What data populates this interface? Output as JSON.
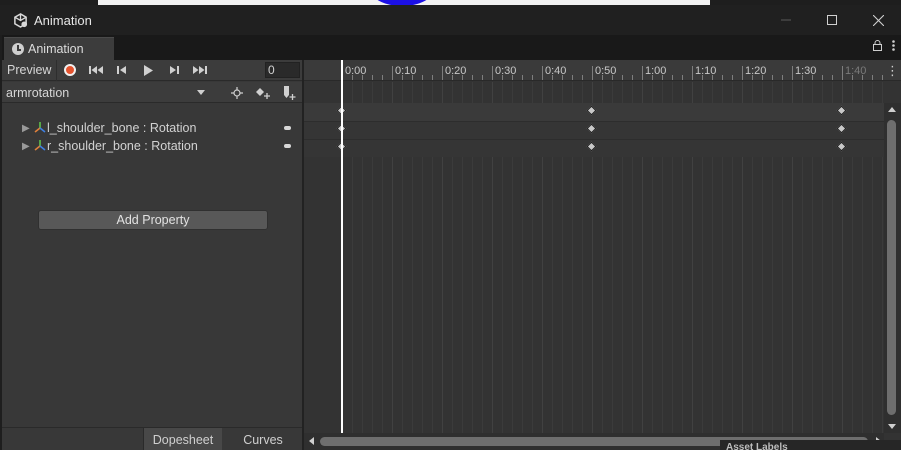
{
  "window": {
    "title": "Animation",
    "icon": "unity-icon",
    "controls": [
      "minimize-icon",
      "maximize-icon",
      "close-icon"
    ]
  },
  "tab": {
    "label": "Animation",
    "icon": "clock-icon",
    "tools": [
      "lock-icon",
      "kebab-menu-icon"
    ]
  },
  "toolbar": {
    "preview_label": "Preview",
    "buttons": [
      "record-icon",
      "first-key-icon",
      "prev-key-icon",
      "play-icon",
      "next-key-icon",
      "last-key-icon"
    ],
    "frame_value": "0"
  },
  "clip": {
    "selected": "armrotation",
    "tools": [
      "filter-by-selection-icon",
      "add-keyframe-icon",
      "add-event-icon"
    ]
  },
  "properties": [
    {
      "label": "l_shoulder_bone : Rotation",
      "icon": "bone-icon"
    },
    {
      "label": "r_shoulder_bone : Rotation",
      "icon": "bone-icon"
    }
  ],
  "add_property_label": "Add Property",
  "bottom_tabs": {
    "dopesheet": "Dopesheet",
    "curves": "Curves",
    "active": "Dopesheet"
  },
  "timeline": {
    "ticks": [
      "0:00",
      "0:10",
      "0:20",
      "0:30",
      "0:40",
      "0:50",
      "1:00",
      "1:10",
      "1:20",
      "1:30",
      "1:40"
    ],
    "keyframe_times": [
      "0:00",
      "0:50",
      "1:40"
    ],
    "playhead_time": "0:00"
  },
  "background_editor_text": "Asset Labels",
  "colors": {
    "record": "#e4532f",
    "playhead": "#ffffff",
    "keyframe": "#c9c9c9",
    "scene_blob": "#1c10e6"
  }
}
